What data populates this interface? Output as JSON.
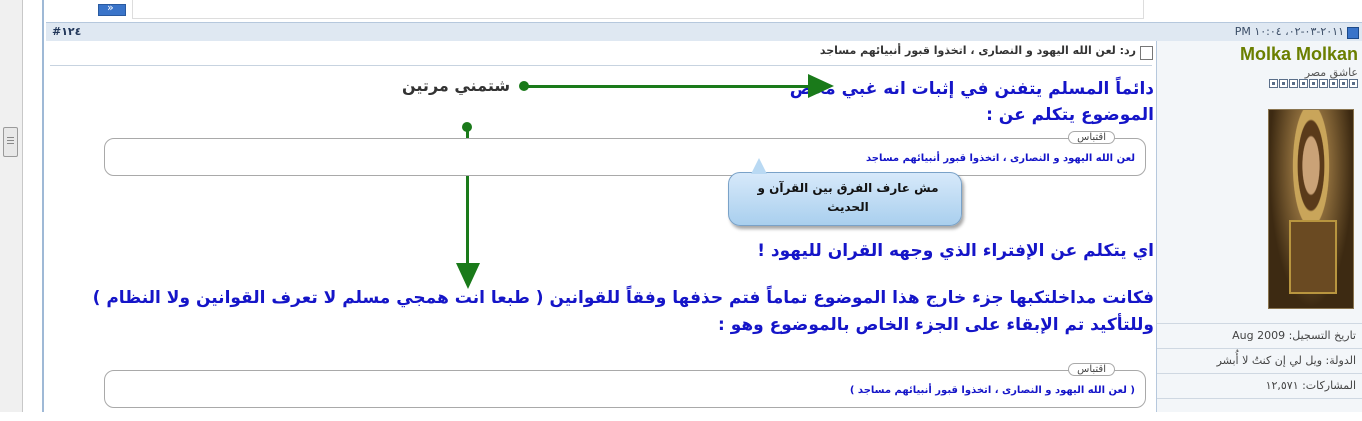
{
  "post": {
    "id": "#١٢٤",
    "date": "٢٠١١-٠٣-٠٢، ١٠:٠٤ PM",
    "subject": "رد: لعن الله اليهود و النصارى ، اتخذوا قبور أنبيائهم مساجد"
  },
  "user": {
    "name": "Molka Molkan",
    "title": "عاشق مصر",
    "reg_date": "تاريخ التسجيل: Aug 2009",
    "country": "الدولة: ويل لي إن كنتُ لا أُبشر",
    "posts": "المشاركات: ١٢,٥٧١"
  },
  "content": {
    "line1": "دائماً المسلم يتفنن في إثبات انه غبي محض",
    "line2": "الموضوع يتكلم عن :",
    "annotation_insult": "شتمني مرتين",
    "quote1": {
      "label": "اقتباس",
      "text": "لعن الله اليهود و النصارى ، اتخذوا قبور أنبيائهم مساجد"
    },
    "bubble": "مش عارف الفرق بين القرآن و الحديث",
    "line3": "اي يتكلم عن الإفتراء الذي وجهه القران لليهود !",
    "paragraph": "فكانت مداخلتكبها جزء خارج هذا الموضوع تماماً فتم حذفها وفقاً للقوانين ( طبعا انت همجي مسلم لا تعرف القوانين ولا النظام ) وللتأكيد تم الإبقاء على الجزء الخاص بالموضوع وهو :",
    "quote2": {
      "label": "اقتباس",
      "text": "( لعن الله اليهود و النصارى ، اتخذوا قبور أنبيائهم مساجد )"
    }
  },
  "colors": {
    "text_blue": "#1515c8",
    "arrow_green": "#1a7a1a",
    "username_olive": "#6b7f00",
    "header_bg": "#dfe8f2"
  }
}
